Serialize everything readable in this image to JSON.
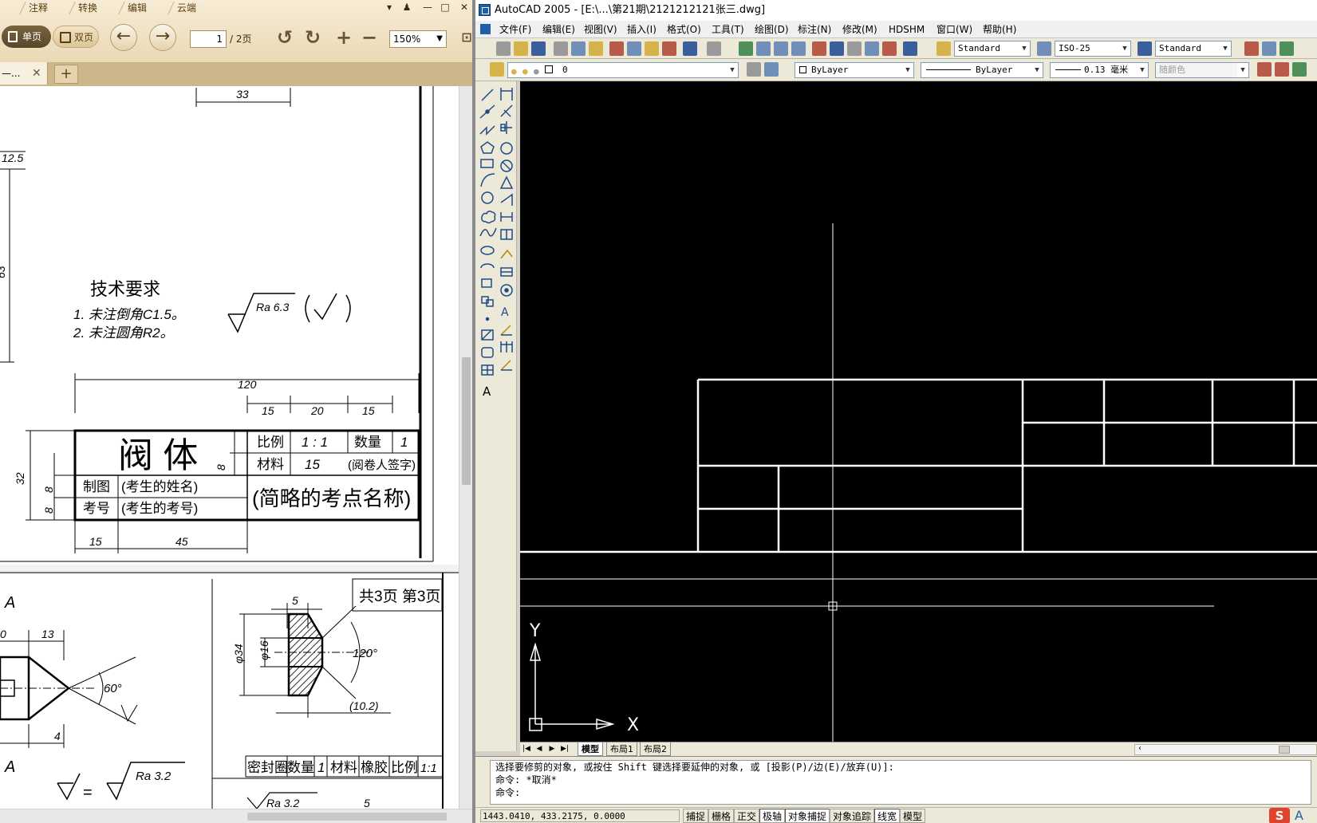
{
  "pdf_reader": {
    "menu_tabs": [
      "注释",
      "转换",
      "编辑",
      "云端"
    ],
    "view_single_label": "单页",
    "view_double_label": "双页",
    "current_page": "1",
    "page_total": "/ 2页",
    "zoom": "150%",
    "doc_tab_label": "—...",
    "doc_tab_close": "✕",
    "tab_add": "+",
    "drawing": {
      "dim_33": "33",
      "dim_12_5": "12.5",
      "dim_63": "63",
      "tech_title": "技术要求",
      "tech_item_1": "1. 未注倒角C1.5。",
      "tech_item_2": "2. 未注圆角R2。",
      "roughness_1": "Ra 6.3",
      "dim_120": "120",
      "dim_15a": "15",
      "dim_20": "20",
      "dim_15b": "15",
      "dim_32": "32",
      "dim_8a": "8",
      "dim_8b": "8",
      "dim_8c": "8",
      "dim_15c": "15",
      "dim_45": "45",
      "part_name": "阀 体",
      "scale_label": "比例",
      "scale_value": "1 : 1",
      "qty_label": "数量",
      "qty_value": "1",
      "material_label": "材料",
      "material_value": "15",
      "signature_label": "(阅卷人签字)",
      "drawn_label": "制图",
      "drawn_value": "(考生的姓名)",
      "number_label": "考号",
      "number_value": "(考生的考号)",
      "venue_label": "(简略的考点名称)",
      "section_a_top": "A",
      "section_a_bottom": "A",
      "dim_13": "13",
      "dim_0": "0",
      "dim_4": "4",
      "angle_60": "60°",
      "roughness_2": "Ra 3.2",
      "pages_label": "共3页 第3页",
      "dim_5a": "5",
      "dim_34": "φ34",
      "dim_16": "φ16",
      "angle_120": "120°",
      "dim_10_2": "(10.2)",
      "seal_label": "密封圈",
      "seal_qty_label": "数量",
      "seal_qty_value": "1",
      "seal_mat_label": "材料",
      "seal_mat_value": "橡胶",
      "seal_scale_label": "比例",
      "seal_scale_value": "1:1",
      "roughness_3": "Ra 3.2",
      "dim_5b": "5"
    }
  },
  "autocad": {
    "title": "AutoCAD 2005 - [E:\\...\\第21期\\2121212121张三.dwg]",
    "menus": [
      "文件(F)",
      "编辑(E)",
      "视图(V)",
      "插入(I)",
      "格式(O)",
      "工具(T)",
      "绘图(D)",
      "标注(N)",
      "修改(M)",
      "HDSHM",
      "窗口(W)",
      "帮助(H)"
    ],
    "text_style": "Standard",
    "dim_style": "ISO-25",
    "table_style": "Standard",
    "layer": "0",
    "color": "ByLayer",
    "linetype": "ByLayer",
    "lineweight": "0.13 毫米",
    "plot_style": "随颜色",
    "layout_tabs": [
      "模型",
      "布局1",
      "布局2"
    ],
    "command_lines": [
      "选择要修剪的对象, 或按住 Shift 键选择要延伸的对象, 或 [投影(P)/边(E)/放弃(U)]:",
      "命令: *取消*",
      "命令:"
    ],
    "coordinates": "1443.0410, 433.2175, 0.0000",
    "status_buttons": [
      "捕捉",
      "栅格",
      "正交",
      "极轴",
      "对象捕捉",
      "对象追踪",
      "线宽",
      "模型"
    ],
    "ucs_x": "X",
    "ucs_y": "Y",
    "ime_label": "A"
  },
  "colors": {
    "cad_background": "#000000",
    "cad_geometry": "#ffffff",
    "pdf_toolbar": "#eedfbf"
  }
}
